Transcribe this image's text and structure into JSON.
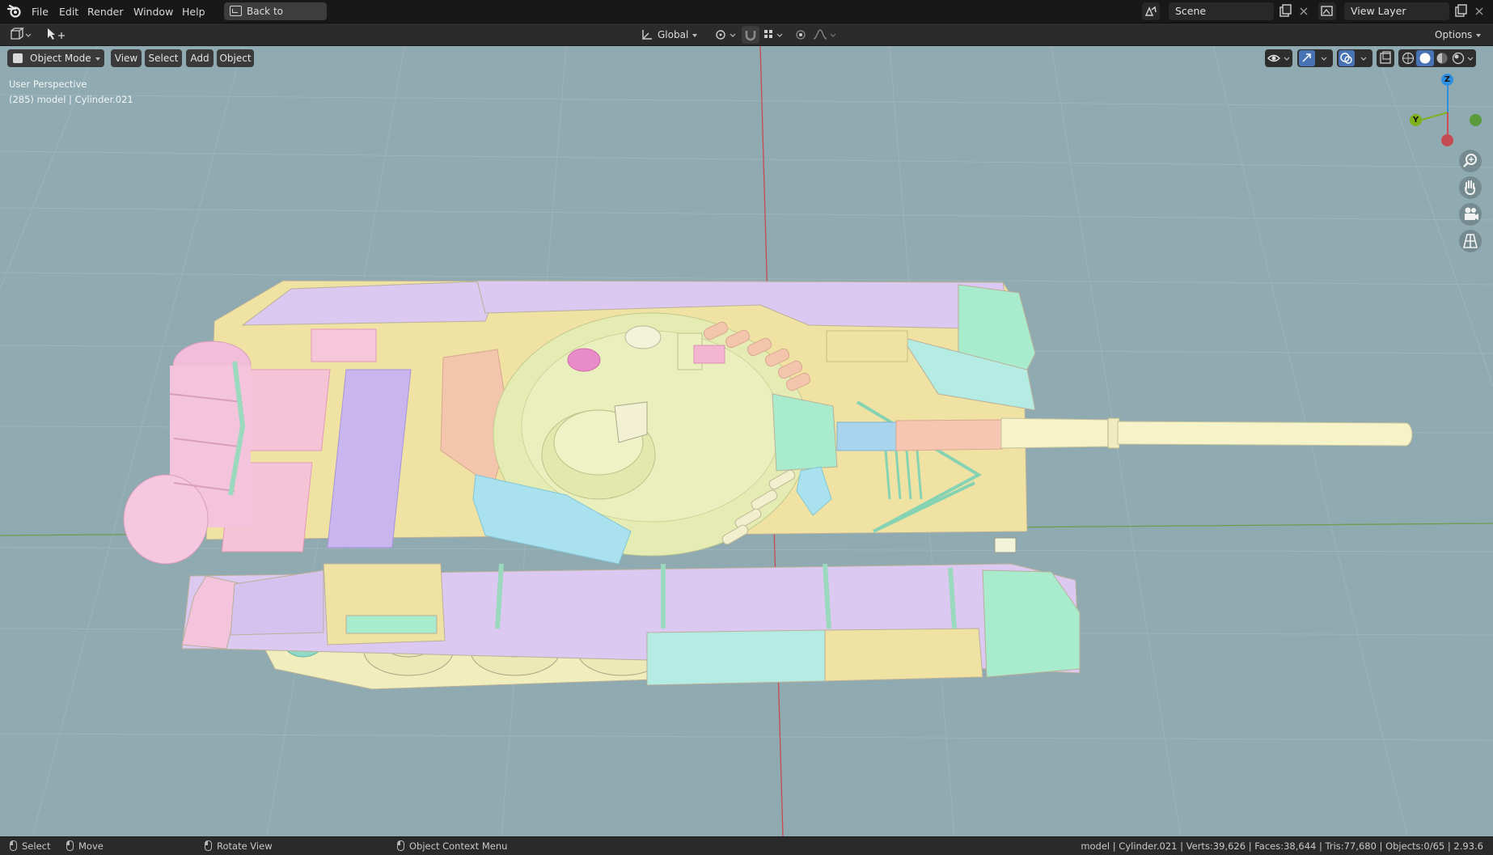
{
  "menubar": {
    "items": [
      "File",
      "Edit",
      "Render",
      "Window",
      "Help"
    ],
    "back_button": "Back to Previous",
    "scene_name": "Scene",
    "view_layer": "View Layer"
  },
  "toolbar": {
    "transform_orientation": "Global",
    "options_label": "Options"
  },
  "viewport_header": {
    "mode": "Object Mode",
    "menus": [
      "View",
      "Select",
      "Add",
      "Object"
    ]
  },
  "viewport": {
    "perspective": "User Perspective",
    "object_info": "(285) model | Cylinder.021",
    "axes": {
      "z": "Z",
      "y": "Y"
    },
    "background_color": "#8faab0"
  },
  "statusbar": {
    "select": "Select",
    "move": "Move",
    "rotate": "Rotate View",
    "context_menu": "Object Context Menu",
    "stats": "model | Cylinder.021 | Verts:39,626 | Faces:38,644 | Tris:77,680 | Objects:0/65 | 2.93.6"
  },
  "colors": {
    "ui_dark": "#181818",
    "ui_header": "#2b2b2b",
    "axis_x": "#d04a57",
    "axis_y": "#7fb11f",
    "axis_z": "#2e8ee0"
  }
}
